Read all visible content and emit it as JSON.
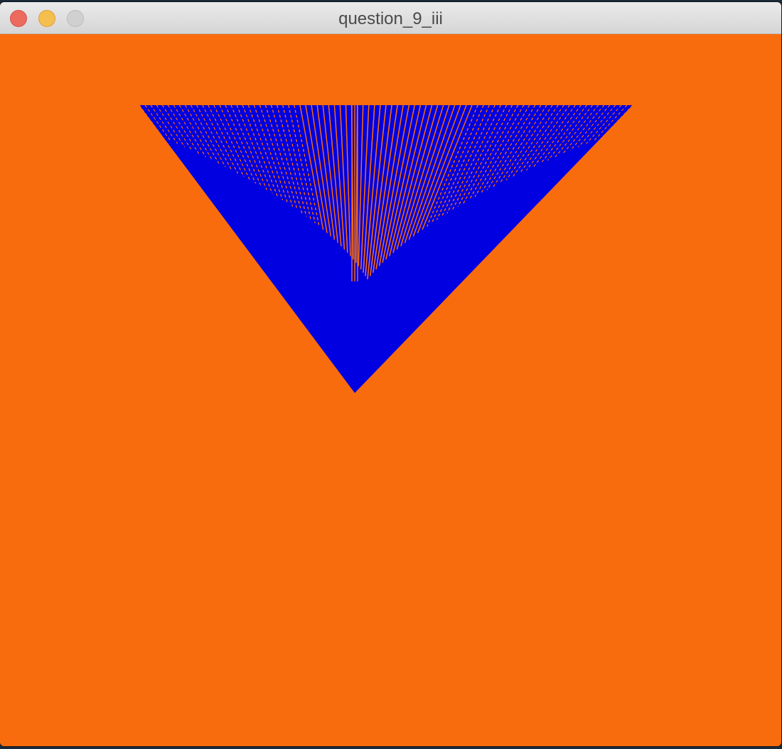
{
  "window": {
    "title": "question_9_iii"
  },
  "colors": {
    "background": "#f96c0d",
    "fill": "#0000e0",
    "titlebar": "#e1e1e1",
    "close": "#ed6a5e",
    "minimize": "#f5bf4f",
    "zoom": "#d0d0d0"
  },
  "icons": {
    "close": "close-traffic-light-icon",
    "minimize": "minimize-traffic-light-icon",
    "zoom": "zoom-traffic-light-icon"
  }
}
